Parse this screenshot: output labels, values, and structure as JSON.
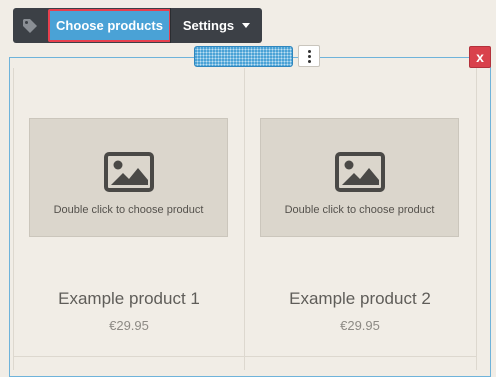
{
  "toolbar": {
    "tag_icon": "tag-icon",
    "choose_label": "Choose products",
    "settings_label": "Settings",
    "settings_icon": "chevron-down-icon"
  },
  "controls": {
    "more_icon": "more-vertical-icon",
    "close_label": "x"
  },
  "colors": {
    "toolbar_bg": "#3c4046",
    "accent_blue": "#4aa2d6",
    "highlight_red": "#e8404e",
    "close_red": "#d9414c",
    "canvas_bg": "#f1ede6",
    "placeholder_bg": "#dbd6cc"
  },
  "products": [
    {
      "placeholder_text": "Double click to choose product",
      "name": "Example product 1",
      "price": "€29.95",
      "image_icon": "image-icon"
    },
    {
      "placeholder_text": "Double click to choose product",
      "name": "Example product 2",
      "price": "€29.95",
      "image_icon": "image-icon"
    }
  ]
}
